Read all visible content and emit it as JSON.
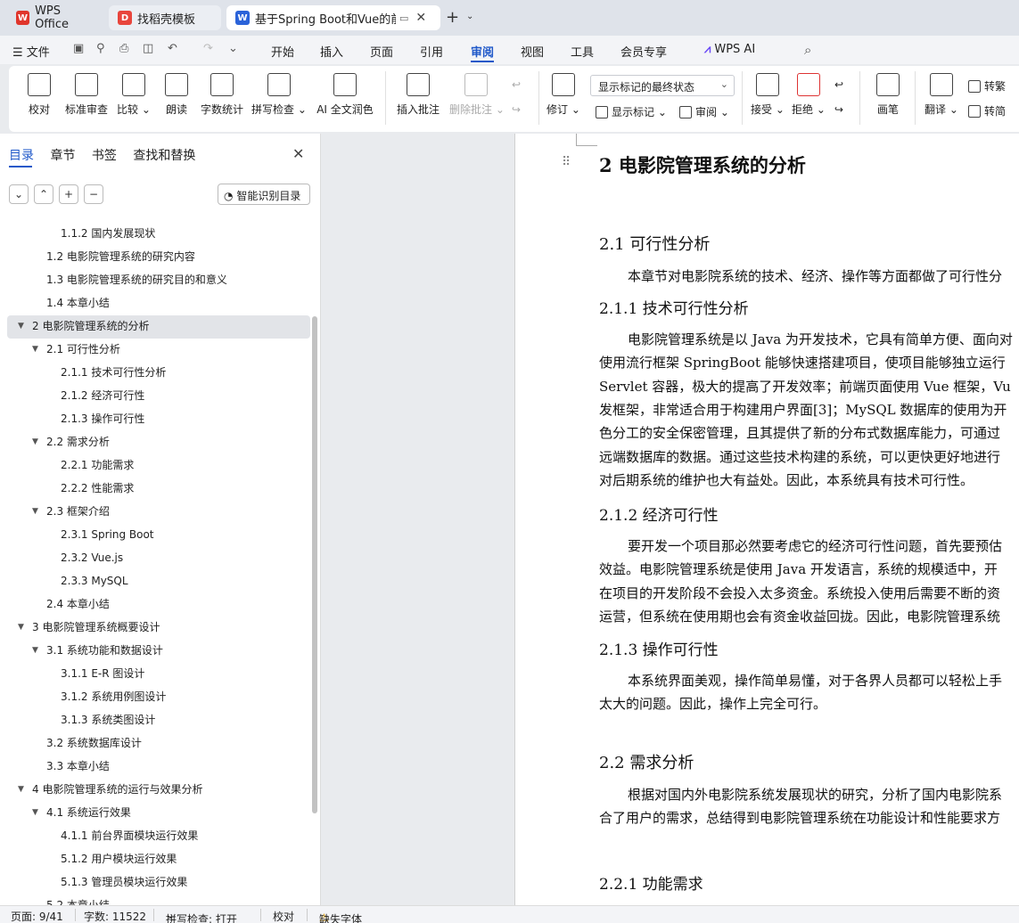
{
  "titlebar": {
    "tabs": [
      {
        "label": "WPS Office"
      },
      {
        "label": "找稻壳模板"
      },
      {
        "label": "基于Spring Boot和Vue的前端"
      }
    ],
    "new_tab": "+"
  },
  "menubar": {
    "file_label": "文件",
    "items": [
      "开始",
      "插入",
      "页面",
      "引用",
      "审阅",
      "视图",
      "工具",
      "会员专享"
    ],
    "ai_label": "WPS AI",
    "active": "审阅"
  },
  "ribbon": {
    "buttons": [
      {
        "label": "校对"
      },
      {
        "label": "标准审查"
      },
      {
        "label": "比较"
      },
      {
        "label": "朗读"
      },
      {
        "label": "字数统计"
      },
      {
        "label": "拼写检查"
      },
      {
        "label": "AI 全文润色"
      },
      {
        "label": "插入批注"
      },
      {
        "label": "删除批注"
      },
      {
        "label": "修订"
      },
      {
        "label": "接受"
      },
      {
        "label": "拒绝"
      },
      {
        "label": "画笔"
      },
      {
        "label": "翻译"
      }
    ],
    "markup_select": "显示标记的最终状态",
    "show_markup": "显示标记",
    "review": "审阅",
    "to_traditional": "转繁",
    "to_simplified": "转简"
  },
  "nav": {
    "tabs": [
      "目录",
      "章节",
      "书签",
      "查找和替换"
    ],
    "ai_toc_button": "智能识别目录",
    "toc": [
      {
        "text": "1.1.2  国内发展现状",
        "level": 3
      },
      {
        "text": "1.2 电影院管理系统的研究内容",
        "level": 2
      },
      {
        "text": "1.3  电影院管理系统的研究目的和意义",
        "level": 2
      },
      {
        "text": "1.4  本章小结",
        "level": 2
      },
      {
        "text": "2  电影院管理系统的分析",
        "level": 1,
        "selected": true,
        "expanded": true
      },
      {
        "text": "2.1  可行性分析",
        "level": 2,
        "expanded": true
      },
      {
        "text": "2.1.1  技术可行性分析",
        "level": 3
      },
      {
        "text": "2.1.2  经济可行性",
        "level": 3
      },
      {
        "text": "2.1.3  操作可行性",
        "level": 3
      },
      {
        "text": "2.2  需求分析",
        "level": 2,
        "expanded": true
      },
      {
        "text": "2.2.1  功能需求",
        "level": 3
      },
      {
        "text": "2.2.2  性能需求",
        "level": 3
      },
      {
        "text": "2.3  框架介绍",
        "level": 2,
        "expanded": true
      },
      {
        "text": "2.3.1 Spring Boot",
        "level": 3
      },
      {
        "text": "2.3.2 Vue.js",
        "level": 3
      },
      {
        "text": "2.3.3 MySQL",
        "level": 3
      },
      {
        "text": "2.4  本章小结",
        "level": 2
      },
      {
        "text": "3  电影院管理系统概要设计",
        "level": 1,
        "expanded": true
      },
      {
        "text": "3.1  系统功能和数据设计",
        "level": 2,
        "expanded": true
      },
      {
        "text": "3.1.1 E-R 图设计",
        "level": 3
      },
      {
        "text": "3.1.2  系统用例图设计",
        "level": 3
      },
      {
        "text": "3.1.3  系统类图设计",
        "level": 3
      },
      {
        "text": "3.2  系统数据库设计",
        "level": 2
      },
      {
        "text": "3.3  本章小结",
        "level": 2
      },
      {
        "text": "4  电影院管理系统的运行与效果分析",
        "level": 1,
        "expanded": true
      },
      {
        "text": "4.1  系统运行效果",
        "level": 2,
        "expanded": true
      },
      {
        "text": "4.1.1  前台界面模块运行效果",
        "level": 3
      },
      {
        "text": "5.1.2  用户模块运行效果",
        "level": 3
      },
      {
        "text": "5.1.3  管理员模块运行效果",
        "level": 3
      },
      {
        "text": "5.2  本章小结",
        "level": 2
      }
    ]
  },
  "doc": {
    "h1": "2  电影院管理系统的分析",
    "h2_1": "2.1  可行性分析",
    "p_intro": "本章节对电影院系统的技术、经济、操作等方面都做了可行性分",
    "h3_1": "2.1.1  技术可行性分析",
    "tech": [
      "电影院管理系统是以 Java 为开发技术，它具有简单方便、面向对",
      "使用流行框架 SpringBoot 能够快速搭建项目，使项目能够独立运行",
      "Servlet 容器，极大的提高了开发效率；前端页面使用 Vue 框架，Vu",
      "发框架，非常适合用于构建用户界面[3]；MySQL 数据库的使用为开",
      "色分工的安全保密管理，且其提供了新的分布式数据库能力，可通过",
      "远端数据库的数据。通过这些技术构建的系统，可以更快更好地进行",
      "对后期系统的维护也大有益处。因此，本系统具有技术可行性。"
    ],
    "h3_2": "2.1.2  经济可行性",
    "econ": [
      "要开发一个项目那必然要考虑它的经济可行性问题，首先要预估",
      "效益。电影院管理系统是使用 Java 开发语言，系统的规模适中，开",
      "在项目的开发阶段不会投入太多资金。系统投入使用后需要不断的资",
      "运营，但系统在使用期也会有资金收益回拢。因此，电影院管理系统"
    ],
    "h3_3": "2.1.3  操作可行性",
    "oper": [
      "本系统界面美观，操作简单易懂，对于各界人员都可以轻松上手",
      "太大的问题。因此，操作上完全可行。"
    ],
    "h2_2": "2.2  需求分析",
    "req": [
      "根据对国内外电影院系统发展现状的研究，分析了国内电影院系",
      "合了用户的需求，总结得到电影院管理系统在功能设计和性能要求方"
    ],
    "h3_4": "2.2.1  功能需求"
  },
  "status": {
    "page": "页面: 9/41",
    "words": "字数: 11522",
    "spell": "拼写检查: 打开",
    "proof": "校对",
    "missing_font": "缺失字体"
  },
  "colors": {
    "accent": "#1f58c9",
    "wps_red": "#e0352b",
    "docer_red": "#e8453c",
    "writer_blue": "#2b63d9"
  }
}
